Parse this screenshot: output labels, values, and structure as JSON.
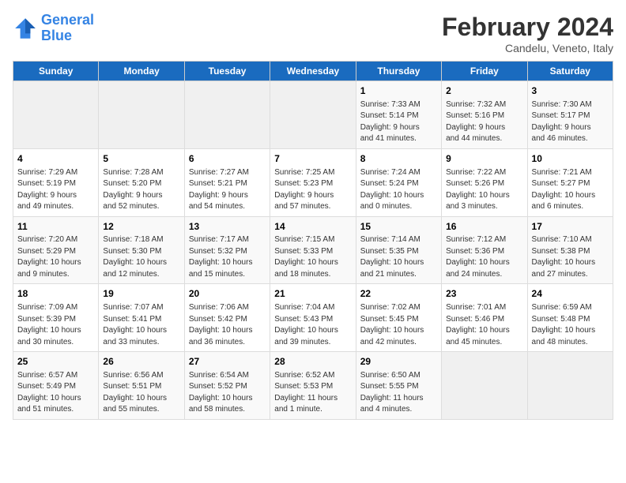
{
  "header": {
    "logo_line1": "General",
    "logo_line2": "Blue",
    "title": "February 2024",
    "subtitle": "Candelu, Veneto, Italy"
  },
  "columns": [
    "Sunday",
    "Monday",
    "Tuesday",
    "Wednesday",
    "Thursday",
    "Friday",
    "Saturday"
  ],
  "rows": [
    [
      {
        "day": "",
        "info": ""
      },
      {
        "day": "",
        "info": ""
      },
      {
        "day": "",
        "info": ""
      },
      {
        "day": "",
        "info": ""
      },
      {
        "day": "1",
        "info": "Sunrise: 7:33 AM\nSunset: 5:14 PM\nDaylight: 9 hours\nand 41 minutes."
      },
      {
        "day": "2",
        "info": "Sunrise: 7:32 AM\nSunset: 5:16 PM\nDaylight: 9 hours\nand 44 minutes."
      },
      {
        "day": "3",
        "info": "Sunrise: 7:30 AM\nSunset: 5:17 PM\nDaylight: 9 hours\nand 46 minutes."
      }
    ],
    [
      {
        "day": "4",
        "info": "Sunrise: 7:29 AM\nSunset: 5:19 PM\nDaylight: 9 hours\nand 49 minutes."
      },
      {
        "day": "5",
        "info": "Sunrise: 7:28 AM\nSunset: 5:20 PM\nDaylight: 9 hours\nand 52 minutes."
      },
      {
        "day": "6",
        "info": "Sunrise: 7:27 AM\nSunset: 5:21 PM\nDaylight: 9 hours\nand 54 minutes."
      },
      {
        "day": "7",
        "info": "Sunrise: 7:25 AM\nSunset: 5:23 PM\nDaylight: 9 hours\nand 57 minutes."
      },
      {
        "day": "8",
        "info": "Sunrise: 7:24 AM\nSunset: 5:24 PM\nDaylight: 10 hours\nand 0 minutes."
      },
      {
        "day": "9",
        "info": "Sunrise: 7:22 AM\nSunset: 5:26 PM\nDaylight: 10 hours\nand 3 minutes."
      },
      {
        "day": "10",
        "info": "Sunrise: 7:21 AM\nSunset: 5:27 PM\nDaylight: 10 hours\nand 6 minutes."
      }
    ],
    [
      {
        "day": "11",
        "info": "Sunrise: 7:20 AM\nSunset: 5:29 PM\nDaylight: 10 hours\nand 9 minutes."
      },
      {
        "day": "12",
        "info": "Sunrise: 7:18 AM\nSunset: 5:30 PM\nDaylight: 10 hours\nand 12 minutes."
      },
      {
        "day": "13",
        "info": "Sunrise: 7:17 AM\nSunset: 5:32 PM\nDaylight: 10 hours\nand 15 minutes."
      },
      {
        "day": "14",
        "info": "Sunrise: 7:15 AM\nSunset: 5:33 PM\nDaylight: 10 hours\nand 18 minutes."
      },
      {
        "day": "15",
        "info": "Sunrise: 7:14 AM\nSunset: 5:35 PM\nDaylight: 10 hours\nand 21 minutes."
      },
      {
        "day": "16",
        "info": "Sunrise: 7:12 AM\nSunset: 5:36 PM\nDaylight: 10 hours\nand 24 minutes."
      },
      {
        "day": "17",
        "info": "Sunrise: 7:10 AM\nSunset: 5:38 PM\nDaylight: 10 hours\nand 27 minutes."
      }
    ],
    [
      {
        "day": "18",
        "info": "Sunrise: 7:09 AM\nSunset: 5:39 PM\nDaylight: 10 hours\nand 30 minutes."
      },
      {
        "day": "19",
        "info": "Sunrise: 7:07 AM\nSunset: 5:41 PM\nDaylight: 10 hours\nand 33 minutes."
      },
      {
        "day": "20",
        "info": "Sunrise: 7:06 AM\nSunset: 5:42 PM\nDaylight: 10 hours\nand 36 minutes."
      },
      {
        "day": "21",
        "info": "Sunrise: 7:04 AM\nSunset: 5:43 PM\nDaylight: 10 hours\nand 39 minutes."
      },
      {
        "day": "22",
        "info": "Sunrise: 7:02 AM\nSunset: 5:45 PM\nDaylight: 10 hours\nand 42 minutes."
      },
      {
        "day": "23",
        "info": "Sunrise: 7:01 AM\nSunset: 5:46 PM\nDaylight: 10 hours\nand 45 minutes."
      },
      {
        "day": "24",
        "info": "Sunrise: 6:59 AM\nSunset: 5:48 PM\nDaylight: 10 hours\nand 48 minutes."
      }
    ],
    [
      {
        "day": "25",
        "info": "Sunrise: 6:57 AM\nSunset: 5:49 PM\nDaylight: 10 hours\nand 51 minutes."
      },
      {
        "day": "26",
        "info": "Sunrise: 6:56 AM\nSunset: 5:51 PM\nDaylight: 10 hours\nand 55 minutes."
      },
      {
        "day": "27",
        "info": "Sunrise: 6:54 AM\nSunset: 5:52 PM\nDaylight: 10 hours\nand 58 minutes."
      },
      {
        "day": "28",
        "info": "Sunrise: 6:52 AM\nSunset: 5:53 PM\nDaylight: 11 hours\nand 1 minute."
      },
      {
        "day": "29",
        "info": "Sunrise: 6:50 AM\nSunset: 5:55 PM\nDaylight: 11 hours\nand 4 minutes."
      },
      {
        "day": "",
        "info": ""
      },
      {
        "day": "",
        "info": ""
      }
    ]
  ]
}
